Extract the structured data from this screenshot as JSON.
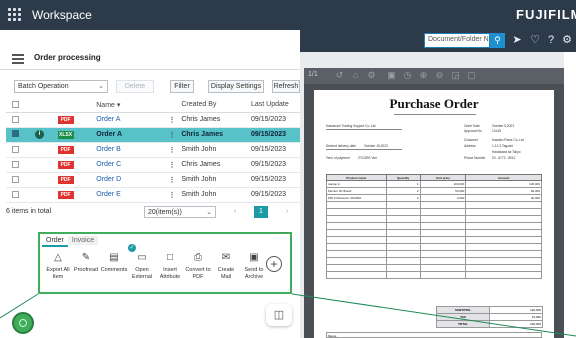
{
  "app": {
    "title": "Workspace",
    "brand": "FUJIFILM"
  },
  "search": {
    "placeholder": "Document/Folder N"
  },
  "header": {
    "title": "Order processing"
  },
  "toolbar": {
    "batch_dropdown": "Batch Operation",
    "delete_label": "Delete",
    "filter_label": "Filter",
    "display_settings_label": "Display Settings",
    "refresh_label": "Refresh"
  },
  "table": {
    "columns": [
      "Name",
      "Created By",
      "Last Update"
    ],
    "rows": [
      {
        "type": "PDF",
        "name": "Order A",
        "created_by": "Chris James",
        "date": "09/15/2023",
        "selected": false,
        "info": false
      },
      {
        "type": "XLSX",
        "name": "Order A",
        "created_by": "Chris James",
        "date": "09/15/2023",
        "selected": true,
        "info": true
      },
      {
        "type": "PDF",
        "name": "Order B",
        "created_by": "Smith John",
        "date": "09/15/2023",
        "selected": false,
        "info": false
      },
      {
        "type": "PDF",
        "name": "Order C",
        "created_by": "Chris James",
        "date": "09/15/2023",
        "selected": false,
        "info": false
      },
      {
        "type": "PDF",
        "name": "Order D",
        "created_by": "Smith John",
        "date": "09/15/2023",
        "selected": false,
        "info": false
      },
      {
        "type": "PDF",
        "name": "Order E",
        "created_by": "Smith John",
        "date": "09/15/2023",
        "selected": false,
        "info": false
      }
    ]
  },
  "pager": {
    "count_text": "6 items in total",
    "per_page": "20(item(s))",
    "current_page": "1"
  },
  "action_panel": {
    "tabs": [
      "Order",
      "Invoice"
    ],
    "actions": [
      "Export All Item",
      "Proofread",
      "Comments",
      "Open External",
      "Insert Attribute",
      "Convert to PDF",
      "Create Mail",
      "Send to Archive"
    ]
  },
  "viewer": {
    "page_indicator": "1/1"
  },
  "document": {
    "title": "Purchase Order",
    "company": "Kawasumi Trading Support Co.,Ltd.",
    "order_date_label": "Order Date",
    "order_date": "October 5,2023",
    "approval_label": "Approval No.",
    "approval": "13145",
    "delivery_label": "Desired delivery date",
    "delivery": "October 15,2023",
    "customer_label": "Customer",
    "customer": "Kawaku Parse Co.,Ltd",
    "address_label": "Address",
    "address": "1-12-3 Tagoshi",
    "address2": "Haraikawa ka Tokyo",
    "payment_label": "Term of payment",
    "payment": "ZYOJRE Vier",
    "phone_label": "Phone Number",
    "phone": "03 - 8772 - 8012",
    "table_headers": [
      "Product name",
      "Quantity",
      "Unit price",
      "Amount"
    ],
    "items": [
      {
        "product": "Laptop A",
        "qty": "1",
        "price": "100,000",
        "amount": "100,000"
      },
      {
        "product": "Monitor 4K Brand",
        "qty": "2",
        "price": "50,000",
        "amount": "90,000"
      },
      {
        "product": "PRI Kl Receiver CN3000",
        "qty": "2",
        "price": "4,000",
        "amount": "30,000"
      }
    ],
    "subtotal_label": "SUBTOTAL",
    "subtotal": "120,000",
    "tax_label": "TAX",
    "tax": "10,000",
    "total_label": "TOTAL",
    "total": "130,000",
    "memo_label": "Memo"
  },
  "colors": {
    "selected_row": "#58c2c9",
    "accent": "#1e9aa5",
    "panel_border": "#3fae5a",
    "topbar": "#2d3a49"
  }
}
